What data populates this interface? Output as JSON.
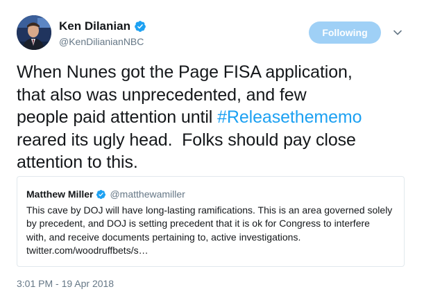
{
  "author": {
    "display_name": "Ken Dilanian",
    "handle": "@KenDilianianNBC",
    "verified": true
  },
  "follow_button": {
    "label": "Following"
  },
  "tweet": {
    "lines": [
      "When Nunes got the Page FISA application,",
      "that also was unprecedented, and few",
      "people paid attention until ",
      "reared its ugly head.  Folks should pay close",
      "attention to this."
    ],
    "hashtag": "#Releasethememo"
  },
  "quoted_tweet": {
    "display_name": "Matthew Miller",
    "handle": "@matthewamiller",
    "verified": true,
    "lines": [
      "This cave by DOJ will have long-lasting ramifications. This is an area governed solely",
      "by precedent, and DOJ is setting precedent that it is ok for Congress to interfere",
      "with, and receive documents pertaining to, active investigations.",
      "twitter.com/woodruffbets/s…"
    ]
  },
  "timestamp": "3:01 PM - 19 Apr 2018",
  "icons": {
    "verified": "verified-badge-icon",
    "caret": "chevron-down-icon"
  },
  "colors": {
    "link": "#1da1f2",
    "following_button": "#9fd0f6",
    "secondary_text": "#657786",
    "primary_text": "#14171a",
    "card_border": "#e1e8ed"
  }
}
